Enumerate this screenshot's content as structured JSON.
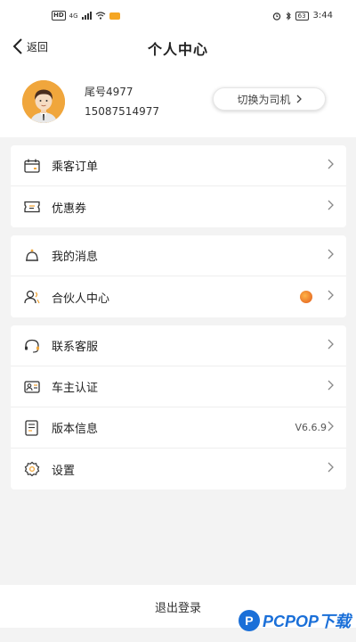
{
  "status_bar": {
    "network": "4G",
    "time": "3:44",
    "battery": "63"
  },
  "header": {
    "back_label": "返回",
    "title": "个人中心"
  },
  "profile": {
    "name": "尾号4977",
    "phone": "15087514977",
    "switch_label": "切换为司机"
  },
  "group1": [
    {
      "label": "乘客订单"
    },
    {
      "label": "优惠券"
    }
  ],
  "group2": [
    {
      "label": "我的消息"
    },
    {
      "label": "合伙人中心"
    }
  ],
  "group3": [
    {
      "label": "联系客服",
      "value": ""
    },
    {
      "label": "车主认证",
      "value": ""
    },
    {
      "label": "版本信息",
      "value": "V6.6.9"
    },
    {
      "label": "设置",
      "value": ""
    }
  ],
  "logout_label": "退出登录",
  "watermark": {
    "text": "PCPOP下载",
    "logo": "P"
  },
  "colors": {
    "accent": "#f0a63c",
    "badge": "#e05a1c",
    "watermark": "#1a6fd8"
  }
}
